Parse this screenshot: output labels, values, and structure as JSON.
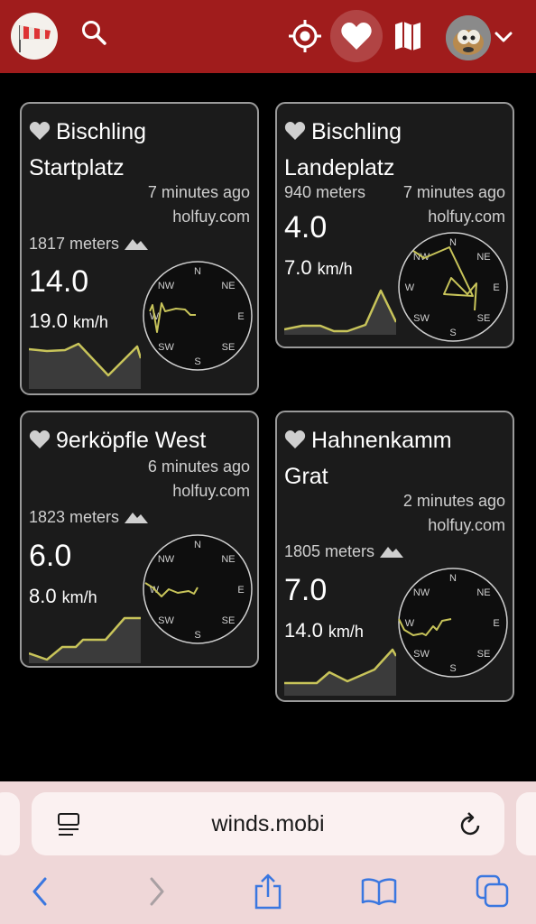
{
  "header": {
    "logo_icon": "windsock-icon",
    "search_icon": "search-icon",
    "locate_icon": "crosshair-icon",
    "favorites_icon": "heart-icon",
    "map_icon": "map-icon",
    "profile_icon": "avatar",
    "menu_icon": "chevron-down-icon",
    "bar_color": "#a01c1c"
  },
  "stations": [
    {
      "name_line1": "Bischling",
      "name_line2": "Startplatz",
      "updated": "7 minutes ago",
      "source": "holfuy.com",
      "altitude": "1817 meters",
      "wind_avg": "14.0",
      "wind_max": "19.0",
      "unit": "km/h",
      "history": [
        5,
        5,
        5.2,
        6,
        4,
        2,
        5.5,
        4
      ],
      "directions": [
        0,
        0,
        0,
        0,
        0,
        0,
        0,
        0
      ]
    },
    {
      "name_line1": "Bischling",
      "name_line2": "Landeplatz",
      "elevation_top": "940 meters",
      "updated": "7 minutes ago",
      "source": "holfuy.com",
      "wind_avg": "4.0",
      "wind_max": "7.0",
      "unit": "km/h",
      "history": [
        1,
        1.4,
        1.4,
        0.8,
        0.8,
        1.5,
        6.5,
        2
      ]
    },
    {
      "name_line1": "9erköpfle West",
      "name_line2": "",
      "updated": "6 minutes ago",
      "source": "holfuy.com",
      "altitude": "1823 meters",
      "wind_avg": "6.0",
      "wind_max": "8.0",
      "unit": "km/h",
      "history": [
        1,
        0.3,
        2,
        2,
        3.2,
        3.2,
        6,
        6
      ]
    },
    {
      "name_line1": "Hahnenkamm",
      "name_line2": "Grat",
      "updated": "2 minutes ago",
      "source": "holfuy.com",
      "altitude": "1805 meters",
      "wind_avg": "7.0",
      "wind_max": "14.0",
      "unit": "km/h",
      "history": [
        1.5,
        1.5,
        3,
        1.5,
        3,
        4.5,
        7,
        5.2
      ]
    }
  ],
  "compass": {
    "n": "N",
    "ne": "NE",
    "e": "E",
    "se": "SE",
    "s": "S",
    "sw": "SW",
    "w": "W",
    "nw": "NW"
  },
  "colors": {
    "card_bg": "#1b1b1b",
    "card_border": "#9a9a9a",
    "wind_line": "#c8c45a",
    "area_fill": "#3b3b3b"
  },
  "browser": {
    "url": "winds.mobi",
    "reader_icon": "reader-icon",
    "reload_icon": "reload-icon",
    "back_icon": "back-arrow-icon",
    "forward_icon": "forward-arrow-icon",
    "share_icon": "share-icon",
    "bookmarks_icon": "book-icon",
    "tabs_icon": "tabs-icon",
    "accent": "#3a77e0"
  }
}
